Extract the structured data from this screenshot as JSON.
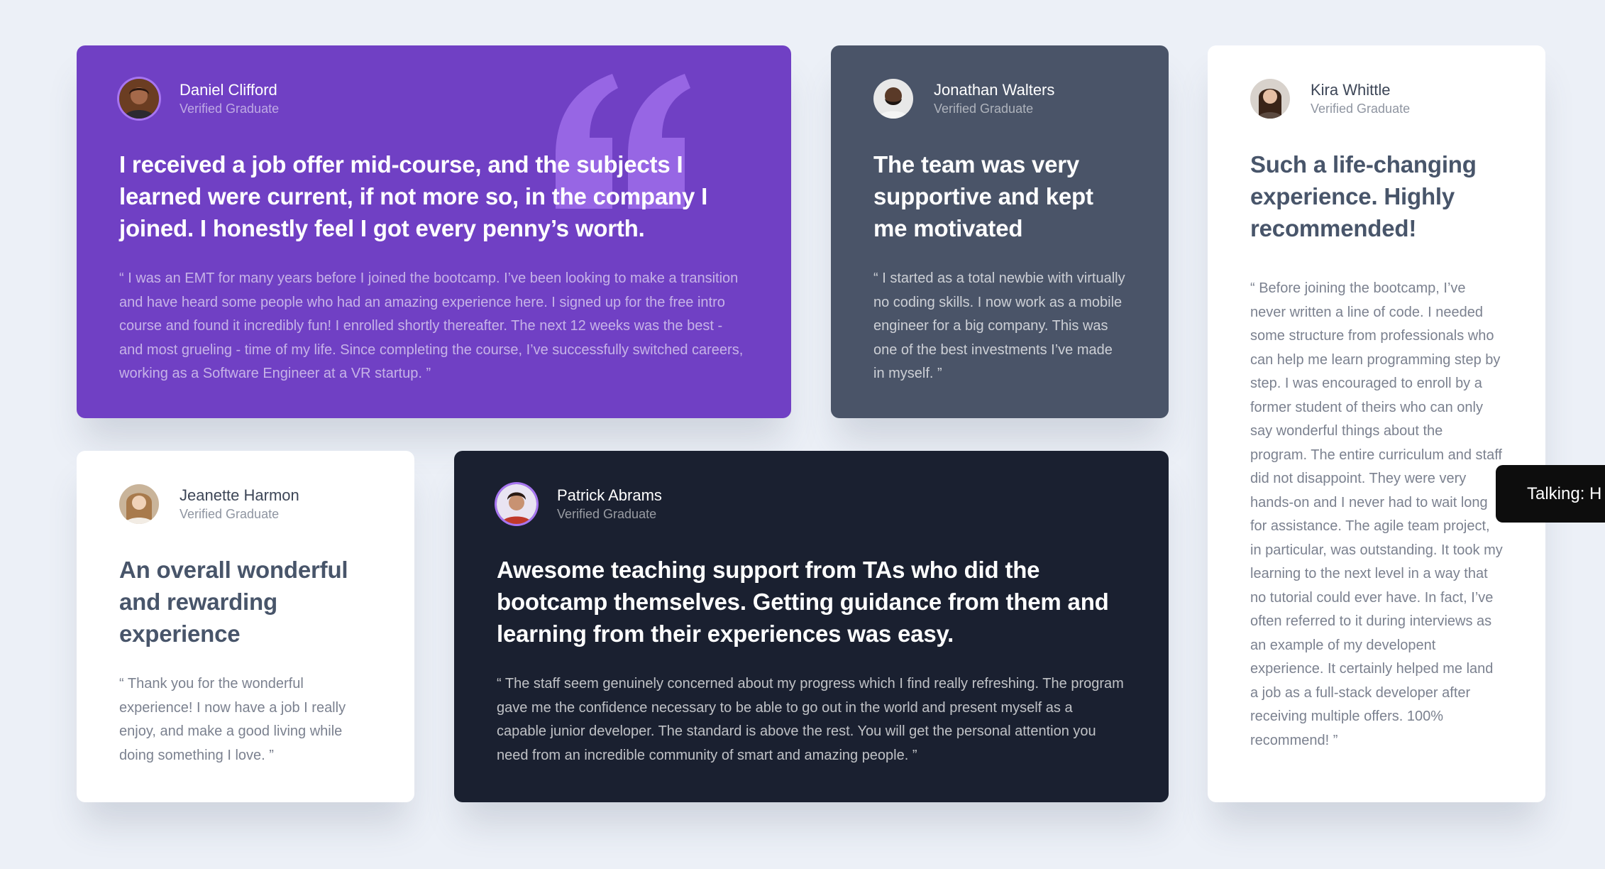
{
  "testimonials": {
    "daniel": {
      "name": "Daniel Clifford",
      "role": "Verified Graduate",
      "headline": "I received a job offer mid-course, and the subjects I learned were current, if not more so, in the company I joined. I honestly feel I got every penny’s worth.",
      "body": "“ I was an EMT for many years before I joined the bootcamp. I’ve been looking to make a transition and have heard some people who had an amazing experience here. I signed up for the free intro course and found it incredibly fun! I enrolled shortly thereafter. The next 12 weeks was the  best - and most grueling - time of my life. Since completing the course, I’ve successfully switched careers, working as a Software Engineer at a VR startup. ”"
    },
    "jonathan": {
      "name": "Jonathan Walters",
      "role": "Verified Graduate",
      "headline": "The team was very supportive and kept me motivated",
      "body": "“ I started as a total newbie with virtually no coding skills. I now work as a mobile engineer for a big company. This was one of the best investments I’ve made in myself. ”"
    },
    "kira": {
      "name": "Kira Whittle",
      "role": "Verified Graduate",
      "headline": "Such a life-changing experience. Highly recommended!",
      "body": "“ Before joining the bootcamp, I’ve never written a line of code. I needed some structure from professionals who can help me learn programming step by step. I was encouraged to enroll by a former student of theirs who can only say wonderful things about the program. The entire curriculum and staff did not disappoint. They were very hands-on and I never had to wait long for assistance. The agile team project, in particular, was outstanding. It took my learning to the next level in a way that no tutorial could ever have. In fact, I’ve often referred to it during interviews as an example of my developent experience. It certainly helped me land a job as a full-stack developer after receiving multiple offers. 100% recommend!  ”"
    },
    "jeanette": {
      "name": "Jeanette Harmon",
      "role": "Verified Graduate",
      "headline": "An overall wonderful and rewarding experience",
      "body": "“ Thank you for the wonderful experience! I now have a job I really enjoy, and make a good living while doing something I love. ”"
    },
    "patrick": {
      "name": "Patrick Abrams",
      "role": "Verified Graduate",
      "headline": "Awesome teaching support from TAs who did the bootcamp themselves. Getting guidance from them and learning from their experiences was easy.",
      "body": "“ The staff seem genuinely concerned about my progress which I find really refreshing. The program gave me the confidence necessary to be able to go out in the world and present myself as a capable junior developer. The standard is above the rest. You will get the personal attention you need from an incredible community of smart and amazing people.  ”"
    }
  },
  "tooltip": {
    "text": "Talking: H"
  },
  "colors": {
    "background": "#ecf0f7",
    "moderate_violet": "#7040c4",
    "grayish_blue": "#4a5468",
    "dark_blackish_blue": "#1a2030",
    "white": "#ffffff",
    "light_violet": "#a775f1"
  }
}
